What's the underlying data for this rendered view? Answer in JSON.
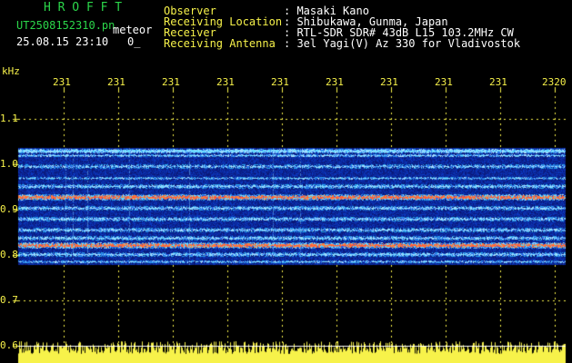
{
  "header": {
    "brand": "H R O F F T",
    "filename": "UT2508152310.pn",
    "filename_suffix": "meteor",
    "datetime": "25.08.15 23:10",
    "datetime_extra": "0_",
    "fields": [
      {
        "label": "Observer",
        "value": ": Masaki Kano"
      },
      {
        "label": "Receiving Location",
        "value": ": Shibukawa, Gunma, Japan"
      },
      {
        "label": "Receiver",
        "value": ": RTL-SDR SDR# 43dB L15 103.2MHz CW"
      },
      {
        "label": "Receiving Antenna",
        "value": ": 3el Yagi(V) Az 330 for Vladivostok"
      }
    ]
  },
  "axis": {
    "y_unit": "kHz",
    "y_ticks": [
      "1.1",
      "1.0",
      "0.9",
      "0.8",
      "0.7",
      "0.6"
    ],
    "x_ticks": [
      "231",
      "231",
      "231",
      "231",
      "231",
      "231",
      "231",
      "231",
      "231",
      "2320"
    ]
  },
  "colors": {
    "label": "#f7f24a",
    "brand": "#2bd64a",
    "text": "#ffffff",
    "background": "#000000"
  }
}
